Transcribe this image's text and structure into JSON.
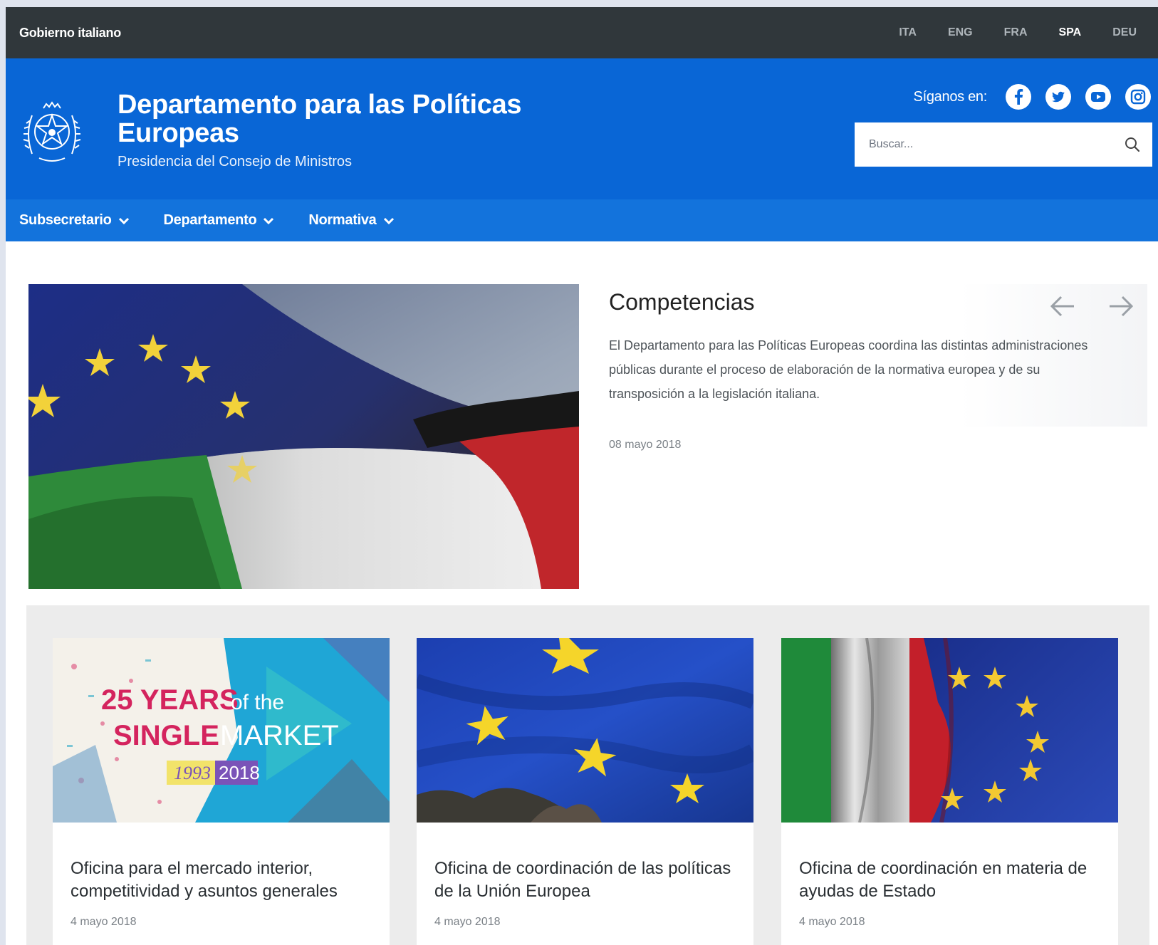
{
  "topbar": {
    "gov_label": "Gobierno italiano",
    "languages": [
      {
        "label": "ITA",
        "active": false
      },
      {
        "label": "ENG",
        "active": false
      },
      {
        "label": "FRA",
        "active": false
      },
      {
        "label": "SPA",
        "active": true
      },
      {
        "label": "DEU",
        "active": false
      }
    ]
  },
  "header": {
    "title_line1": "Departamento para las Políticas",
    "title_line2": "Europeas",
    "subtitle": "Presidencia del Consejo de Ministros",
    "follow_label": "Síganos en:",
    "social": [
      "facebook-icon",
      "twitter-icon",
      "youtube-icon",
      "instagram-icon"
    ],
    "search_placeholder": "Buscar..."
  },
  "nav": {
    "items": [
      {
        "label": "Subsecretario"
      },
      {
        "label": "Departamento"
      },
      {
        "label": "Normativa"
      }
    ]
  },
  "hero": {
    "title": "Competencias",
    "body": "El Departamento para las Políticas Europeas coordina las distintas administraciones públicas durante el proceso de elaboración de la normativa europea y de su transposición a la legislación italiana.",
    "date": "08 mayo 2018"
  },
  "cards": [
    {
      "title": "Oficina para el mercado interior, competitividad y asuntos generales",
      "date": "4 mayo 2018",
      "image_text": {
        "line1": "25 YEARS",
        "of_the": "of the",
        "line2a": "SINGLE",
        "line2b": "MARKET",
        "year1": "1993",
        "year2": "2018"
      }
    },
    {
      "title": "Oficina de coordinación de las políticas de la Unión Europea",
      "date": "4 mayo 2018"
    },
    {
      "title": "Oficina de coordinación en materia de ayudas de Estado",
      "date": "4 mayo 2018"
    }
  ],
  "colors": {
    "topbar": "#30373b",
    "header": "#0966d6",
    "nav": "#1373dc",
    "cards_bg": "#ececec"
  }
}
